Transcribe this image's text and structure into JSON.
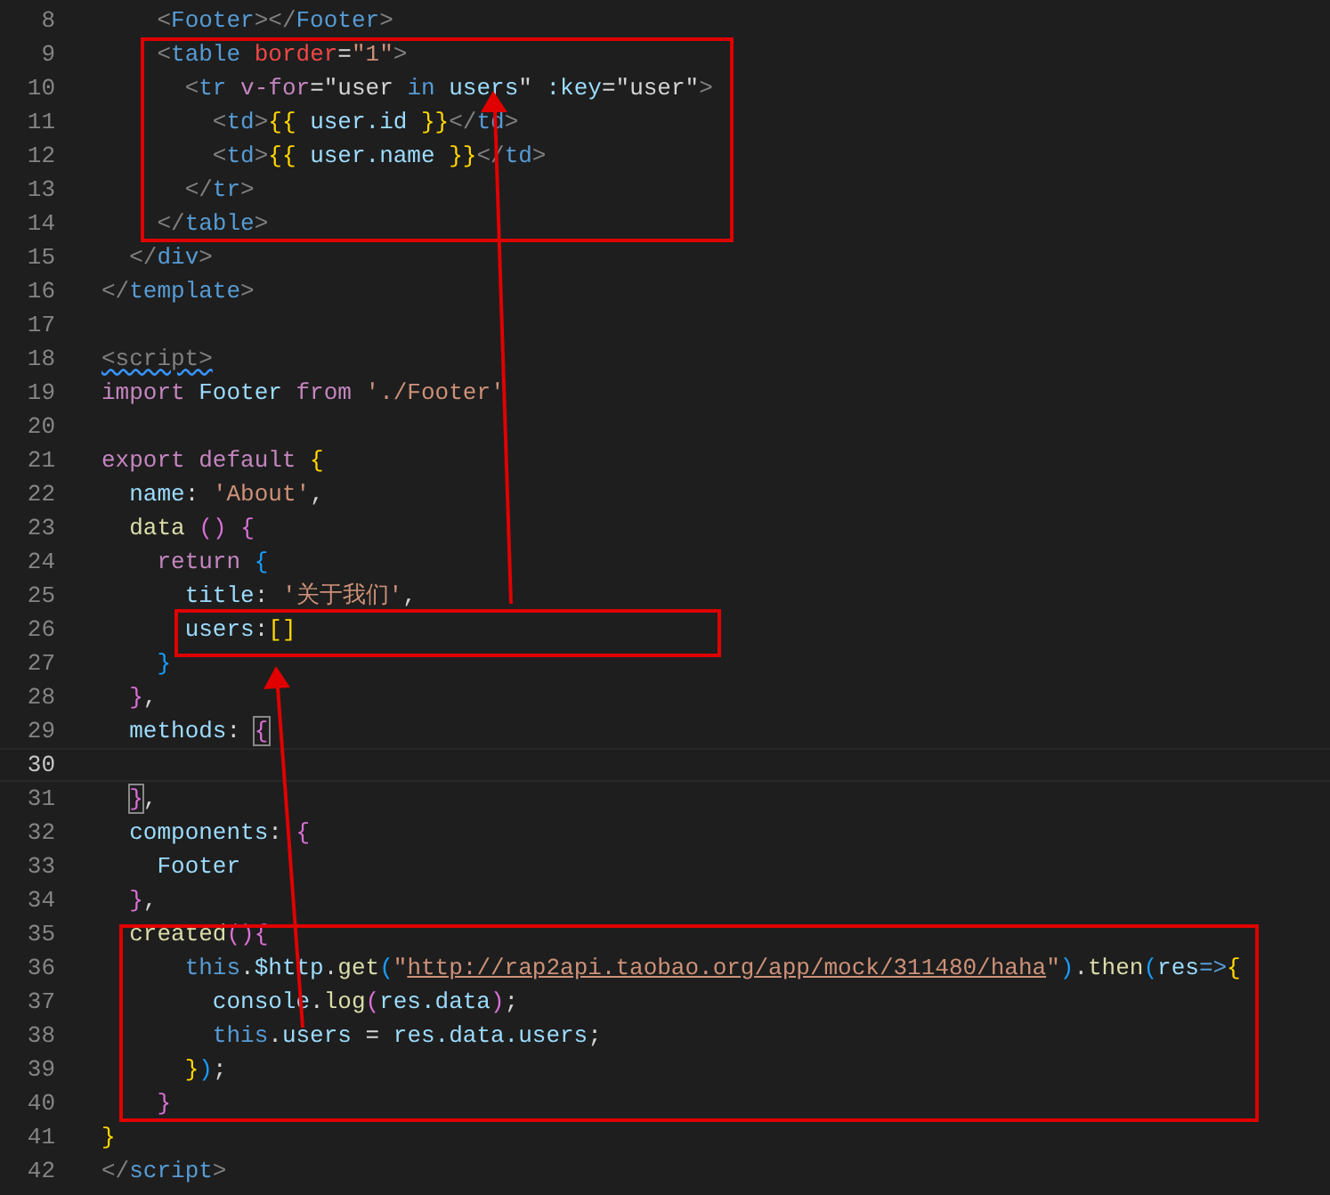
{
  "editor": {
    "lines": [
      {
        "number": "8",
        "current": false,
        "tokens": [
          {
            "t": "    <",
            "kind": "punct"
          },
          {
            "t": "Footer",
            "kind": "tag"
          },
          {
            "t": "></",
            "kind": "punct"
          },
          {
            "t": "Footer",
            "kind": "tag"
          },
          {
            "t": ">",
            "kind": "punct"
          }
        ]
      },
      {
        "number": "9",
        "current": false,
        "tokens": [
          {
            "t": "    <",
            "kind": "punct"
          },
          {
            "t": "table",
            "kind": "tag"
          },
          {
            "t": " border",
            "kind": "attrred"
          },
          {
            "t": "=",
            "kind": "plain"
          },
          {
            "t": "\"1\"",
            "kind": "str"
          },
          {
            "t": ">",
            "kind": "punct"
          }
        ]
      },
      {
        "number": "10",
        "current": false,
        "tokens": [
          {
            "t": "      <",
            "kind": "punct"
          },
          {
            "t": "tr",
            "kind": "tag"
          },
          {
            "t": " v-for",
            "kind": "ctl"
          },
          {
            "t": "=\"user",
            "kind": "plain"
          },
          {
            "t": " in",
            "kind": "kw"
          },
          {
            "t": " users",
            "kind": "var"
          },
          {
            "t": "\"",
            "kind": "plain"
          },
          {
            "t": " :key",
            "kind": "var"
          },
          {
            "t": "=\"user\"",
            "kind": "plain"
          },
          {
            "t": ">",
            "kind": "punct"
          }
        ]
      },
      {
        "number": "11",
        "current": false,
        "tokens": [
          {
            "t": "        <",
            "kind": "punct"
          },
          {
            "t": "td",
            "kind": "tag"
          },
          {
            "t": ">",
            "kind": "punct"
          },
          {
            "t": "{{",
            "kind": "y"
          },
          {
            "t": " user.id ",
            "kind": "var"
          },
          {
            "t": "}}",
            "kind": "y"
          },
          {
            "t": "</",
            "kind": "punct"
          },
          {
            "t": "td",
            "kind": "tag"
          },
          {
            "t": ">",
            "kind": "punct"
          }
        ]
      },
      {
        "number": "12",
        "current": false,
        "tokens": [
          {
            "t": "        <",
            "kind": "punct"
          },
          {
            "t": "td",
            "kind": "tag"
          },
          {
            "t": ">",
            "kind": "punct"
          },
          {
            "t": "{{",
            "kind": "y"
          },
          {
            "t": " user.name ",
            "kind": "var"
          },
          {
            "t": "}}",
            "kind": "y"
          },
          {
            "t": "</",
            "kind": "punct"
          },
          {
            "t": "td",
            "kind": "tag"
          },
          {
            "t": ">",
            "kind": "punct"
          }
        ]
      },
      {
        "number": "13",
        "current": false,
        "tokens": [
          {
            "t": "      </",
            "kind": "punct"
          },
          {
            "t": "tr",
            "kind": "tag"
          },
          {
            "t": ">",
            "kind": "punct"
          }
        ]
      },
      {
        "number": "14",
        "current": false,
        "tokens": [
          {
            "t": "    </",
            "kind": "punct"
          },
          {
            "t": "table",
            "kind": "tag"
          },
          {
            "t": ">",
            "kind": "punct"
          }
        ]
      },
      {
        "number": "15",
        "current": false,
        "tokens": [
          {
            "t": "  </",
            "kind": "punct"
          },
          {
            "t": "div",
            "kind": "tag"
          },
          {
            "t": ">",
            "kind": "punct"
          }
        ]
      },
      {
        "number": "16",
        "current": false,
        "tokens": [
          {
            "t": "</",
            "kind": "punct"
          },
          {
            "t": "template",
            "kind": "tag"
          },
          {
            "t": ">",
            "kind": "punct"
          }
        ]
      },
      {
        "number": "17",
        "current": false
      },
      {
        "number": "18",
        "current": false,
        "tokens": [
          {
            "t": "<script>",
            "kind": "tagwarn"
          }
        ]
      },
      {
        "number": "19",
        "current": false,
        "tokens": [
          {
            "t": "import",
            "kind": "ctl"
          },
          {
            "t": " Footer",
            "kind": "var"
          },
          {
            "t": " from",
            "kind": "ctl"
          },
          {
            "t": " './Footer'",
            "kind": "str"
          }
        ]
      },
      {
        "number": "20",
        "current": false
      },
      {
        "number": "21",
        "current": false,
        "tokens": [
          {
            "t": "export",
            "kind": "ctl"
          },
          {
            "t": " default",
            "kind": "ctl"
          },
          {
            "t": " {",
            "kind": "y"
          }
        ]
      },
      {
        "number": "22",
        "current": false,
        "tokens": [
          {
            "t": "  name",
            "kind": "var"
          },
          {
            "t": ":",
            "kind": "plain"
          },
          {
            "t": " 'About'",
            "kind": "str"
          },
          {
            "t": ",",
            "kind": "plain"
          }
        ]
      },
      {
        "number": "23",
        "current": false,
        "tokens": [
          {
            "t": "  data",
            "kind": "func"
          },
          {
            "t": " ()",
            "kind": "p"
          },
          {
            "t": " {",
            "kind": "p"
          }
        ]
      },
      {
        "number": "24",
        "current": false,
        "tokens": [
          {
            "t": "    return",
            "kind": "ctl"
          },
          {
            "t": " {",
            "kind": "b"
          }
        ]
      },
      {
        "number": "25",
        "current": false,
        "tokens": [
          {
            "t": "      title",
            "kind": "var"
          },
          {
            "t": ":",
            "kind": "plain"
          },
          {
            "t": " '关于我们'",
            "kind": "str"
          },
          {
            "t": ",",
            "kind": "plain"
          }
        ]
      },
      {
        "number": "26",
        "current": false,
        "tokens": [
          {
            "t": "      users",
            "kind": "var"
          },
          {
            "t": ":",
            "kind": "plain"
          },
          {
            "t": "[]",
            "kind": "y"
          }
        ]
      },
      {
        "number": "27",
        "current": false,
        "tokens": [
          {
            "t": "    }",
            "kind": "b"
          }
        ]
      },
      {
        "number": "28",
        "current": false,
        "tokens": [
          {
            "t": "  }",
            "kind": "p"
          },
          {
            "t": ",",
            "kind": "plain"
          }
        ]
      },
      {
        "number": "29",
        "current": false,
        "tokens": [
          {
            "t": "  methods",
            "kind": "var"
          },
          {
            "t": ": ",
            "kind": "plain"
          },
          {
            "t": "{",
            "kind": "match"
          }
        ]
      },
      {
        "number": "30",
        "current": true
      },
      {
        "number": "31",
        "current": false,
        "tokens": [
          {
            "t": "  }",
            "kind": "match"
          },
          {
            "t": ",",
            "kind": "plain"
          }
        ]
      },
      {
        "number": "32",
        "current": false,
        "tokens": [
          {
            "t": "  components",
            "kind": "var"
          },
          {
            "t": ":",
            "kind": "plain"
          },
          {
            "t": " {",
            "kind": "p"
          }
        ]
      },
      {
        "number": "33",
        "current": false,
        "tokens": [
          {
            "t": "    Footer",
            "kind": "var"
          }
        ]
      },
      {
        "number": "34",
        "current": false,
        "tokens": [
          {
            "t": "  }",
            "kind": "p"
          },
          {
            "t": ",",
            "kind": "plain"
          }
        ]
      },
      {
        "number": "35",
        "current": false,
        "tokens": [
          {
            "t": "  created",
            "kind": "func"
          },
          {
            "t": "()",
            "kind": "p"
          },
          {
            "t": "{",
            "kind": "p"
          }
        ]
      },
      {
        "number": "36",
        "current": false,
        "tokens": [
          {
            "t": "      this",
            "kind": "kw"
          },
          {
            "t": ".",
            "kind": "plain"
          },
          {
            "t": "$http",
            "kind": "var"
          },
          {
            "t": ".",
            "kind": "plain"
          },
          {
            "t": "get",
            "kind": "func"
          },
          {
            "t": "(",
            "kind": "b"
          },
          {
            "t": "\"",
            "kind": "str"
          },
          {
            "t": "http://rap2api.taobao.org/app/mock/311480/haha",
            "kind": "link"
          },
          {
            "t": "\"",
            "kind": "str"
          },
          {
            "t": ")",
            "kind": "b"
          },
          {
            "t": ".",
            "kind": "plain"
          },
          {
            "t": "then",
            "kind": "func"
          },
          {
            "t": "(",
            "kind": "b"
          },
          {
            "t": "res",
            "kind": "var"
          },
          {
            "t": "=>",
            "kind": "kw"
          },
          {
            "t": "{",
            "kind": "y"
          }
        ]
      },
      {
        "number": "37",
        "current": false,
        "tokens": [
          {
            "t": "        console",
            "kind": "var"
          },
          {
            "t": ".",
            "kind": "plain"
          },
          {
            "t": "log",
            "kind": "func"
          },
          {
            "t": "(",
            "kind": "p"
          },
          {
            "t": "res.data",
            "kind": "var"
          },
          {
            "t": ")",
            "kind": "p"
          },
          {
            "t": ";",
            "kind": "plain"
          }
        ]
      },
      {
        "number": "38",
        "current": false,
        "tokens": [
          {
            "t": "        this",
            "kind": "kw"
          },
          {
            "t": ".",
            "kind": "plain"
          },
          {
            "t": "users",
            "kind": "var"
          },
          {
            "t": " = ",
            "kind": "plain"
          },
          {
            "t": "res.data.users",
            "kind": "var"
          },
          {
            "t": ";",
            "kind": "plain"
          }
        ]
      },
      {
        "number": "39",
        "current": false,
        "tokens": [
          {
            "t": "      }",
            "kind": "y"
          },
          {
            "t": ")",
            "kind": "b"
          },
          {
            "t": ";",
            "kind": "plain"
          }
        ]
      },
      {
        "number": "40",
        "current": false,
        "tokens": [
          {
            "t": "    }",
            "kind": "p"
          }
        ]
      },
      {
        "number": "41",
        "current": false,
        "tokens": [
          {
            "t": "}",
            "kind": "y"
          }
        ]
      },
      {
        "number": "42",
        "current": false,
        "tokens": [
          {
            "t": "</",
            "kind": "punct"
          },
          {
            "t": "script",
            "kind": "tag"
          },
          {
            "t": ">",
            "kind": "punct"
          }
        ]
      }
    ]
  }
}
